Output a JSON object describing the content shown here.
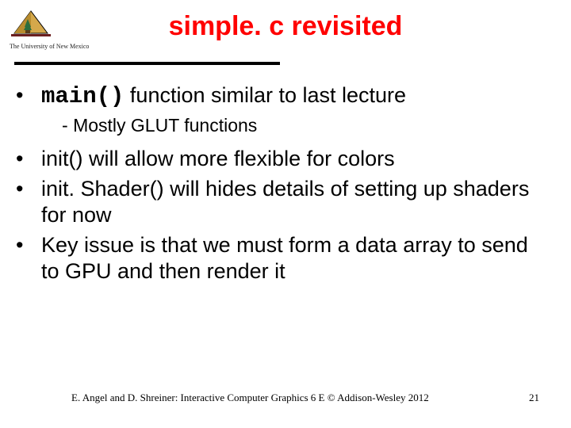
{
  "logo": {
    "org_name": "The University of New Mexico"
  },
  "title": "simple. c revisited",
  "bullets": [
    {
      "pre": "",
      "code": "main()",
      "post": " function similar to last lecture"
    },
    {
      "sub": "Mostly GLUT functions"
    },
    {
      "text": "init() will allow more flexible for colors"
    },
    {
      "text": "init. Shader() will hides details of setting up shaders for now"
    },
    {
      "text": "Key issue is that we must form a data array to send to GPU and then render it"
    }
  ],
  "footer": "E. Angel and D. Shreiner: Interactive Computer Graphics 6 E © Addison-Wesley 2012",
  "page": "21"
}
